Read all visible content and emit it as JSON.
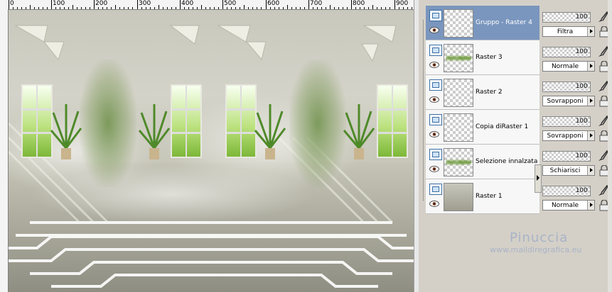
{
  "ruler": {
    "ticks": [
      "0",
      "100",
      "200",
      "300",
      "400",
      "500",
      "600",
      "700",
      "800",
      "900"
    ]
  },
  "layers": [
    {
      "name": "Gruppo - Raster 4",
      "opacity": "100",
      "blend": "Filtra",
      "selected": true,
      "thumb": "empty"
    },
    {
      "name": "Raster 3",
      "opacity": "100",
      "blend": "Normale",
      "selected": false,
      "thumb": "green"
    },
    {
      "name": "Raster 2",
      "opacity": "100",
      "blend": "Sovrapponi",
      "selected": false,
      "thumb": "empty"
    },
    {
      "name": "Copia diRaster 1",
      "opacity": "100",
      "blend": "Sovrapponi",
      "selected": false,
      "thumb": "empty"
    },
    {
      "name": "Selezione innalzata",
      "opacity": "100",
      "blend": "Schiarisci",
      "selected": false,
      "thumb": "green"
    },
    {
      "name": "Raster 1",
      "opacity": "100",
      "blend": "Normale",
      "selected": false,
      "thumb": "fill"
    }
  ],
  "watermark": {
    "name": "Pinuccia",
    "url": "www.maildiregrafica.eu"
  },
  "colors": {
    "selected_row": "#7a96be",
    "panel_bg": "#d4d0c8",
    "watermark": "#a8b3c6"
  },
  "icons": {
    "visibility": "eye-icon",
    "layer_type": "layer-icon",
    "brush": "brush-icon",
    "lock": "lock-icon"
  }
}
